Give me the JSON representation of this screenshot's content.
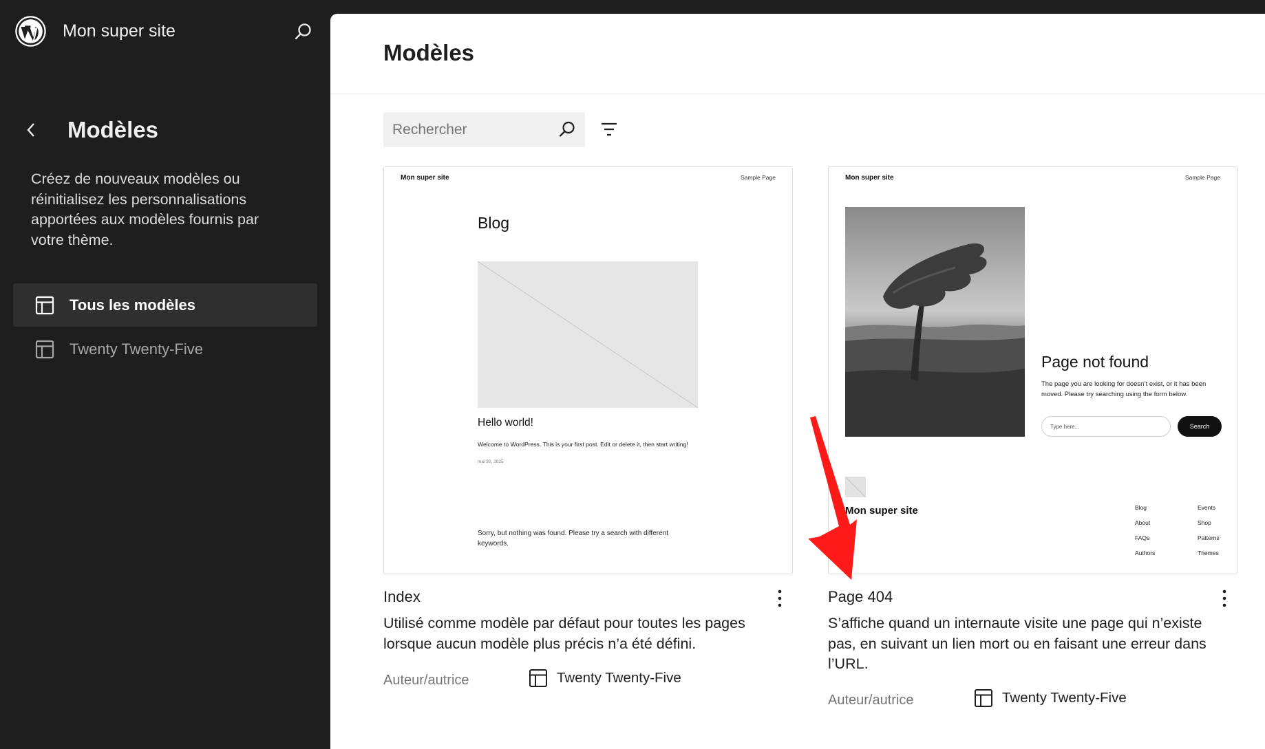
{
  "sidebar": {
    "site_title": "Mon super site",
    "section_title": "Modèles",
    "description": "Créez de nouveaux modèles ou réinitialisez les personnalisations apportées aux modèles fournis par votre thème.",
    "items": [
      {
        "label": "Tous les modèles",
        "active": true
      },
      {
        "label": "Twenty Twenty-Five",
        "active": false
      }
    ]
  },
  "main": {
    "title": "Modèles",
    "search": {
      "placeholder": "Rechercher",
      "value": ""
    },
    "cards": [
      {
        "title": "Index",
        "description": "Utilisé comme modèle par défaut pour toutes les pages lorsque aucun modèle plus précis n’a été défini.",
        "author_label": "Auteur/autrice",
        "theme": "Twenty Twenty-Five",
        "preview": {
          "site_title": "Mon super site",
          "nav_link": "Sample Page",
          "heading": "Blog",
          "post_title": "Hello world!",
          "post_excerpt": "Welcome to WordPress. This is your first post. Edit or delete it, then start writing!",
          "post_date": "mai 30, 2025",
          "no_results": "Sorry, but nothing was found. Please try a search with different keywords."
        }
      },
      {
        "title": "Page 404",
        "description": "S’affiche quand un internaute visite une page qui n’existe pas, en suivant un lien mort ou en faisant une erreur dans l’URL.",
        "author_label": "Auteur/autrice",
        "theme": "Twenty Twenty-Five",
        "preview": {
          "site_title": "Mon super site",
          "nav_link": "Sample Page",
          "heading": "Page not found",
          "message": "The page you are looking for doesn’t exist, or it has been moved. Please try searching using the form below.",
          "search_placeholder": "Type here...",
          "search_button": "Search",
          "footer_site_title": "Mon super site",
          "footer_links_col1": [
            "Blog",
            "About",
            "FAQs",
            "Authors"
          ],
          "footer_links_col2": [
            "Events",
            "Shop",
            "Patterns",
            "Themes"
          ]
        }
      }
    ]
  },
  "colors": {
    "sidebar_bg": "#1e1e1e",
    "active_item_bg": "#2f2f2f",
    "annotation_arrow": "#ff0000"
  }
}
